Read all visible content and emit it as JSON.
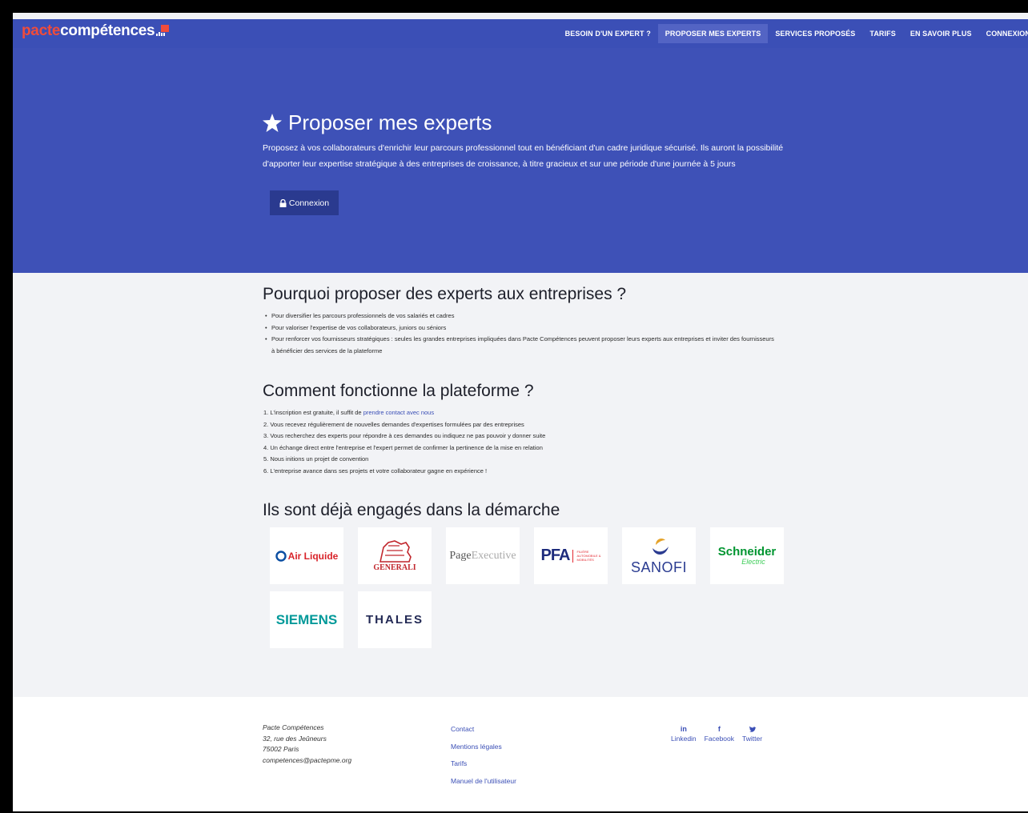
{
  "brand": {
    "part1": "pacte",
    "part2": "compétences"
  },
  "nav": {
    "items": [
      {
        "label": "BESOIN D'UN EXPERT ?",
        "active": false
      },
      {
        "label": "PROPOSER MES EXPERTS",
        "active": true
      },
      {
        "label": "SERVICES PROPOSÉS",
        "active": false
      },
      {
        "label": "TARIFS",
        "active": false
      },
      {
        "label": "EN SAVOIR PLUS",
        "active": false
      },
      {
        "label": "CONNEXION",
        "active": false
      }
    ]
  },
  "hero": {
    "title": "Proposer mes experts",
    "description": "Proposez à vos collaborateurs d'enrichir leur parcours professionnel tout en bénéficiant d'un cadre juridique sécurisé. Ils auront la possibilité d'apporter leur expertise stratégique à des entreprises de croissance, à titre gracieux et sur une période d'une journée à 5 jours",
    "button_label": "Connexion"
  },
  "why": {
    "title": "Pourquoi proposer des experts aux entreprises ?",
    "items": [
      "Pour diversifier les parcours professionnels de vos salariés et cadres",
      "Pour valoriser l'expertise de vos collaborateurs, juniors ou séniors",
      "Pour renforcer vos fournisseurs stratégiques : seules les grandes entreprises impliquées dans Pacte Compétences peuvent proposer leurs experts aux entreprises et inviter des fournisseurs à bénéficier des services de la plateforme"
    ]
  },
  "how": {
    "title": "Comment fonctionne la plateforme ?",
    "item1_prefix": "1. L'inscription est gratuite, il suffit de ",
    "item1_link": "prendre contact avec nous",
    "items": [
      "2. Vous recevez régulièrement de nouvelles demandes d'expertises formulées par des entreprises",
      "3. Vous recherchez des experts pour répondre à ces demandes ou indiquez ne pas pouvoir y donner suite",
      "4. Un échange direct entre l'entreprise et l'expert permet de confirmer la pertinence de la mise en relation",
      "5. Nous initions un projet de convention",
      "6. L'entreprise avance dans ses projets et votre collaborateur gagne en expérience !"
    ]
  },
  "partners": {
    "title": "Ils sont déjà engagés dans la démarche",
    "logos": [
      {
        "name": "Air Liquide",
        "color": "#d8232a",
        "accent": "#0b4ea2"
      },
      {
        "name": "GENERALI",
        "color": "#c1272d"
      },
      {
        "name_a": "Page",
        "name_b": "Executive",
        "color": "#555555",
        "accent": "#999999"
      },
      {
        "name": "PFA",
        "sub": "FILIÈRE AUTOMOBILE & MOBILITÉS",
        "color": "#1d2b7c",
        "accent": "#e3262f"
      },
      {
        "name": "SANOFI",
        "color": "#2b3c91",
        "accent": "#e5a32b"
      },
      {
        "name_a": "Schneider",
        "name_b": "Electric",
        "color": "#3dcd58",
        "accent": "#009530"
      },
      {
        "name": "SIEMENS",
        "color": "#009999"
      },
      {
        "name": "THALES",
        "color": "#232a55"
      }
    ]
  },
  "footer": {
    "address": [
      "Pacte Compétences",
      "32, rue des Jeûneurs",
      "75002 Paris",
      "competences@pactepme.org"
    ],
    "links": [
      "Contact",
      "Mentions légales",
      "Tarifs",
      "Manuel de l'utilisateur"
    ],
    "social": [
      {
        "glyph": "in",
        "label": "Linkedin",
        "icon": "linkedin-icon"
      },
      {
        "glyph": "f",
        "label": "Facebook",
        "icon": "facebook-icon"
      },
      {
        "glyph": "🐦",
        "label": "Twitter",
        "icon": "twitter-icon"
      }
    ]
  },
  "colors": {
    "primary": "#3e51b7",
    "dark_button": "#2a3a8f",
    "brand_red": "#f04c3b"
  }
}
